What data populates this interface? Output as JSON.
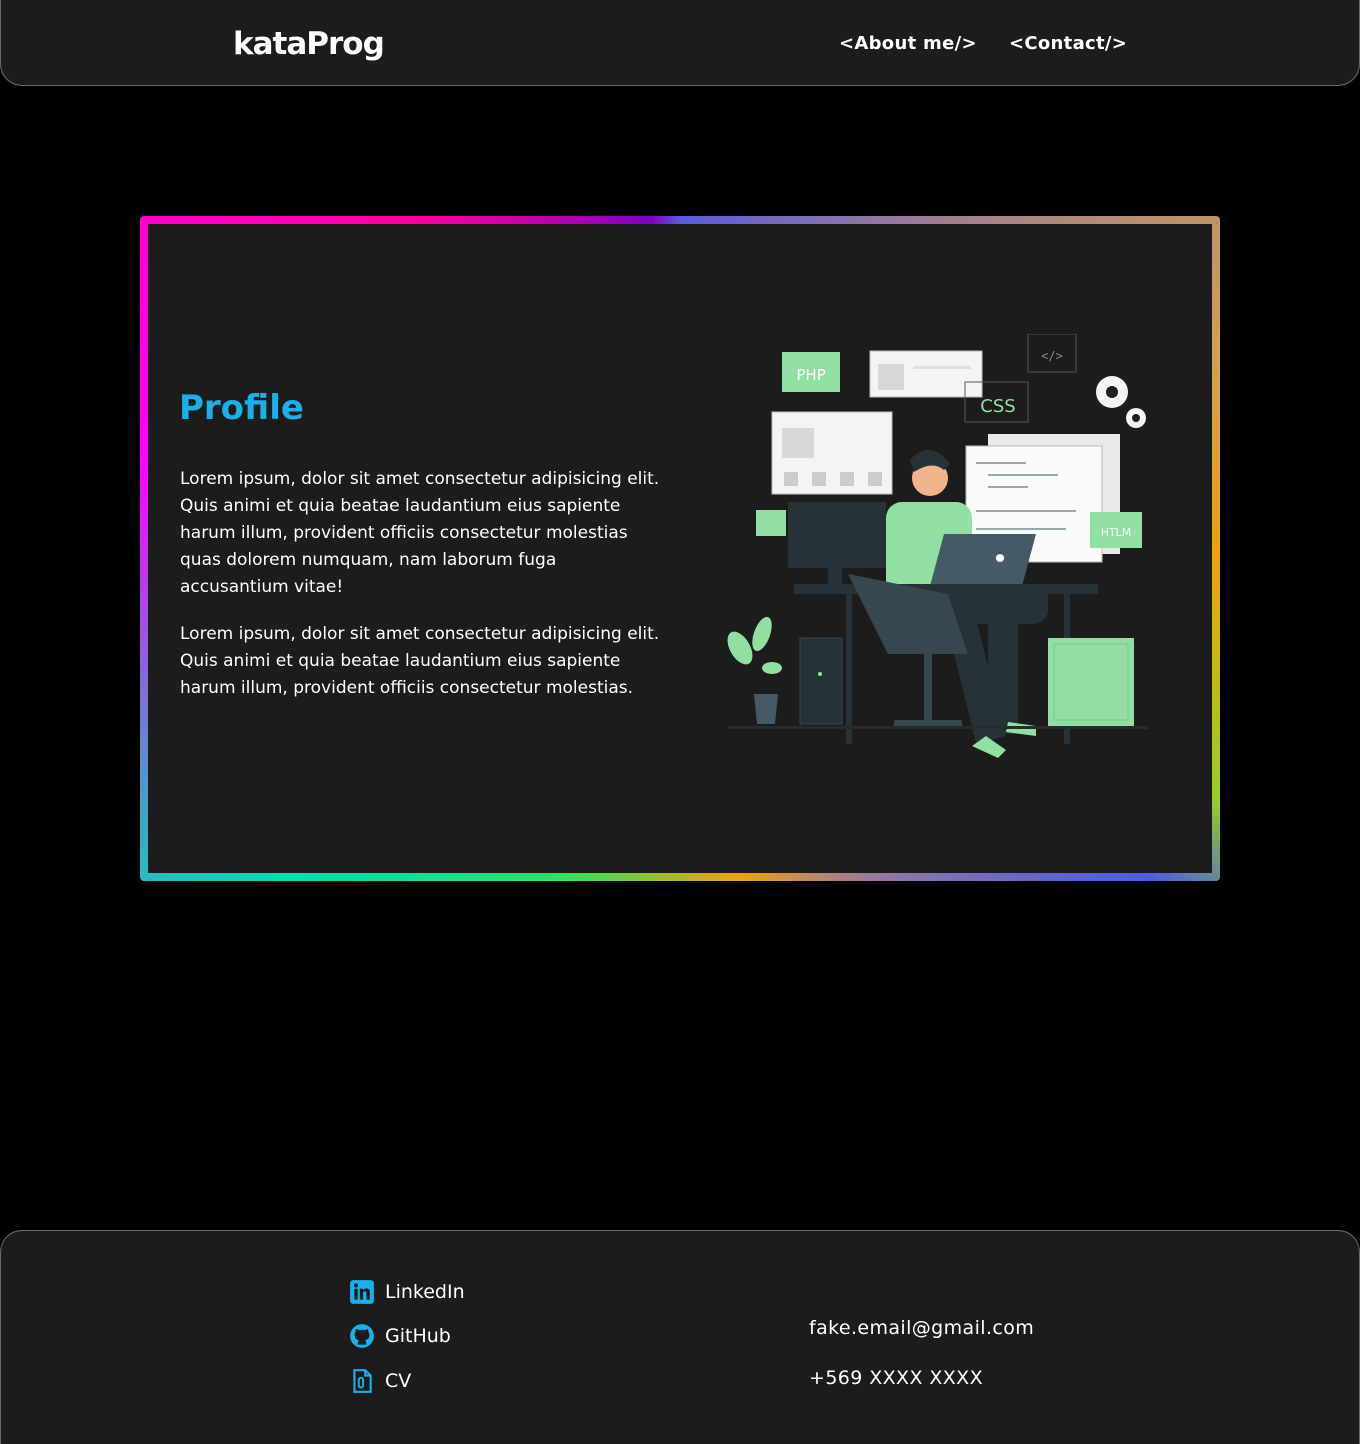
{
  "header": {
    "brand": "kataProg",
    "nav": {
      "about": "<About me/>",
      "contact": "<Contact/>"
    }
  },
  "profile": {
    "title": "Profile",
    "paragraph_1": "Lorem ipsum, dolor sit amet consectetur adipisicing elit. Quis animi et quia beatae laudantium eius sapiente harum illum, provident officiis consectetur molestias quas dolorem numquam, nam laborum fuga accusantium vitae!",
    "paragraph_2": "Lorem ipsum, dolor sit amet consectetur adipisicing elit. Quis animi et quia beatae laudantium eius sapiente harum illum, provident officiis consectetur molestias.",
    "illustration_labels": {
      "php": "PHP",
      "css": "CSS",
      "htlm": "HTLM",
      "code": "</>"
    }
  },
  "footer": {
    "links": {
      "linkedin": "LinkedIn",
      "github": "GitHub",
      "cv": "CV"
    },
    "email": "fake.email@gmail.com",
    "phone": "+569 XXXX XXXX"
  },
  "colors": {
    "accent": "#1ab0e8",
    "panel": "#1c1c1d",
    "background": "#000000",
    "illustration_green": "#92dfa3"
  }
}
